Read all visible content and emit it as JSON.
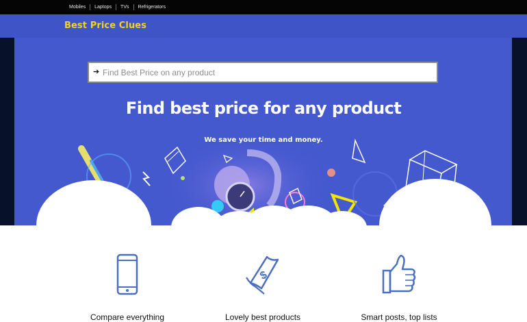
{
  "topnav": {
    "items": [
      {
        "label": "Mobiles"
      },
      {
        "label": "Laptops"
      },
      {
        "label": "TVs"
      },
      {
        "label": "Refrigerators"
      }
    ]
  },
  "header": {
    "logo": "Best Price Clues"
  },
  "search": {
    "placeholder": "Find Best Price on any product",
    "icon": "arrow-right-icon"
  },
  "hero": {
    "title": "Find best price for any product",
    "subtitle": "We save your time and money."
  },
  "features": [
    {
      "label": "Compare everything",
      "icon": "smartphone-icon"
    },
    {
      "label": "Lovely best products",
      "icon": "dollar-bill-icon"
    },
    {
      "label": "Smart posts, top lists",
      "icon": "thumbs-up-icon"
    }
  ],
  "colors": {
    "brand_blue": "#4559cf",
    "logo_yellow": "#f5d31c",
    "icon_blue": "#4a6fc0",
    "nav_bg": "#050505"
  }
}
